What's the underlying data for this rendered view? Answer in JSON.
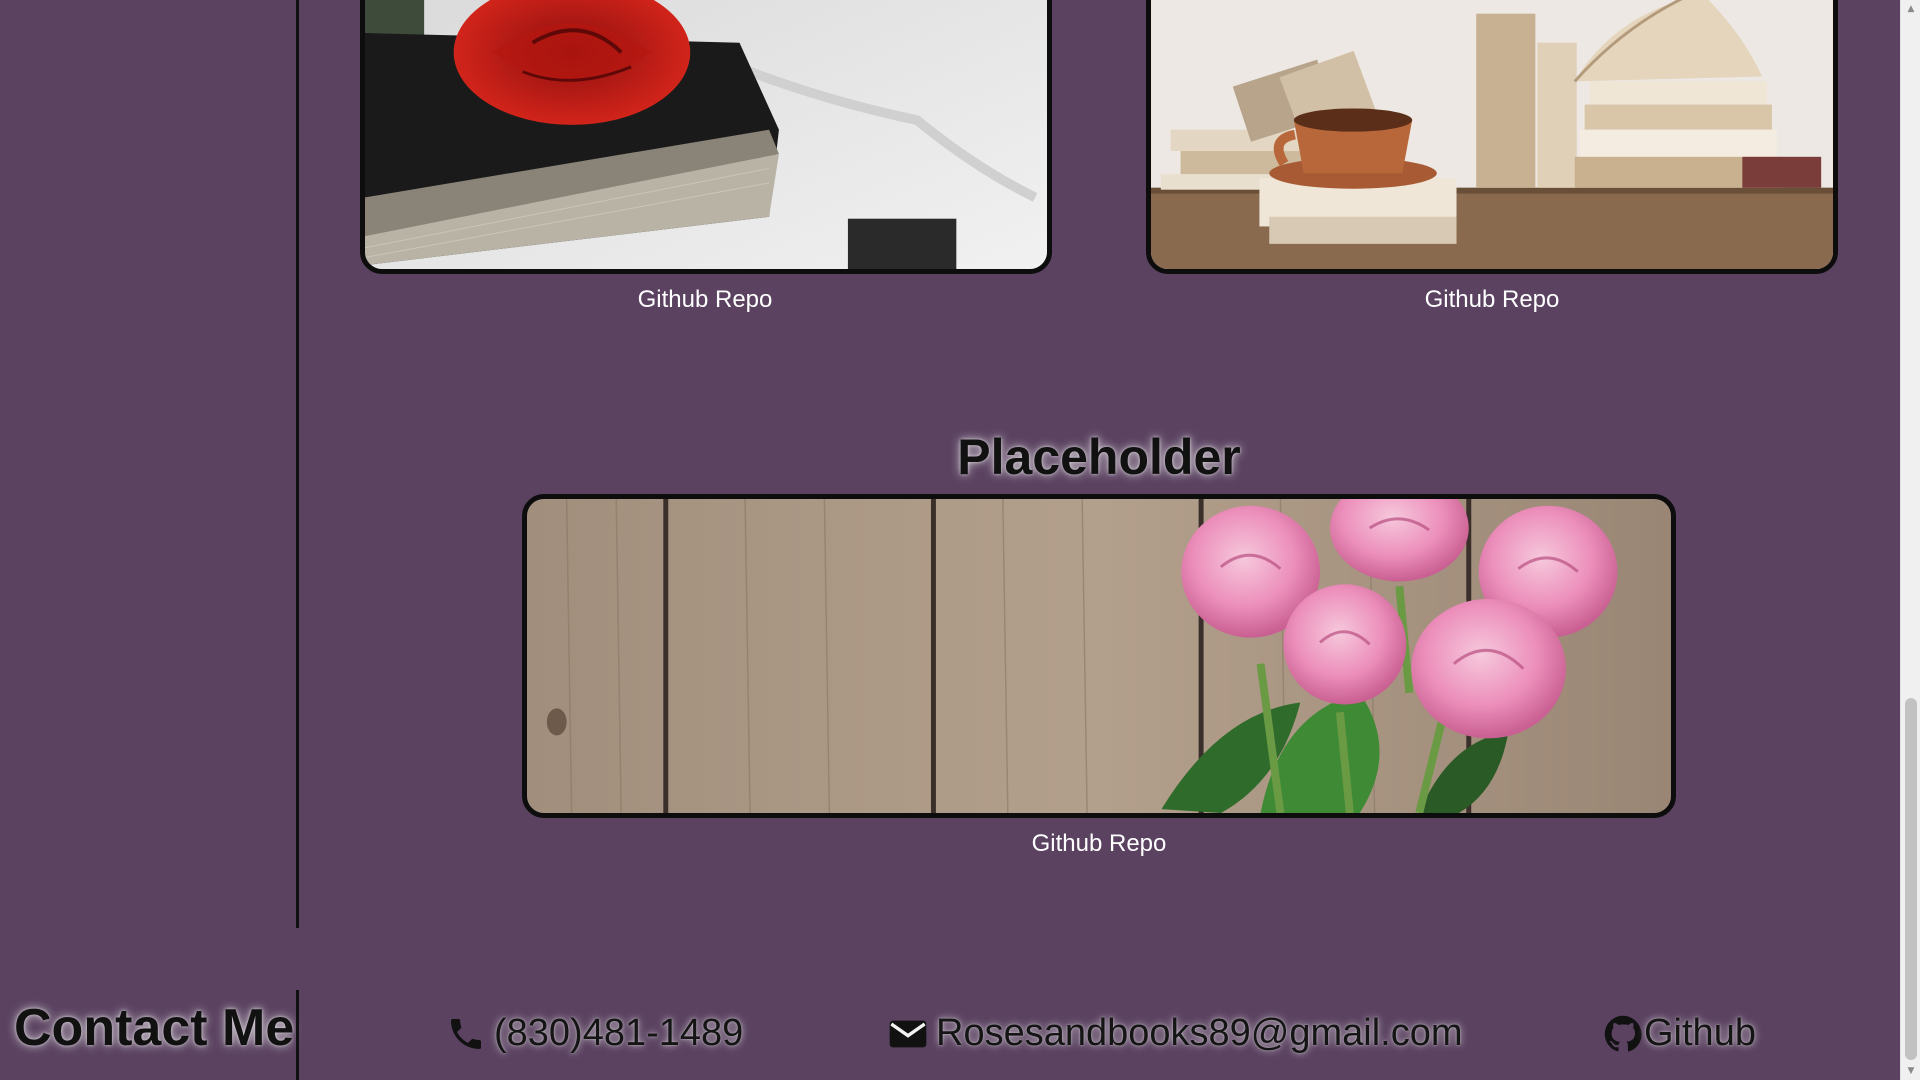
{
  "projects": [
    {
      "image_desc": "red-rose-on-book-image",
      "link_label": "Github Repo"
    },
    {
      "image_desc": "books-and-coffee-cup-image",
      "link_label": "Github Repo"
    },
    {
      "title": "Placeholder",
      "image_desc": "pink-roses-on-wood-image",
      "link_label": "Github Repo"
    }
  ],
  "contact": {
    "heading": "Contact Me",
    "phone": "(830)481-1489",
    "email": "Rosesandbooks89@gmail.com",
    "github": "Github"
  },
  "colors": {
    "background": "#5a4260",
    "text_dark": "#111111",
    "link_text": "#ffffff",
    "card_border": "#0d0d0d"
  },
  "icons": {
    "phone": "phone-icon",
    "email": "envelope-icon",
    "github": "github-icon"
  }
}
